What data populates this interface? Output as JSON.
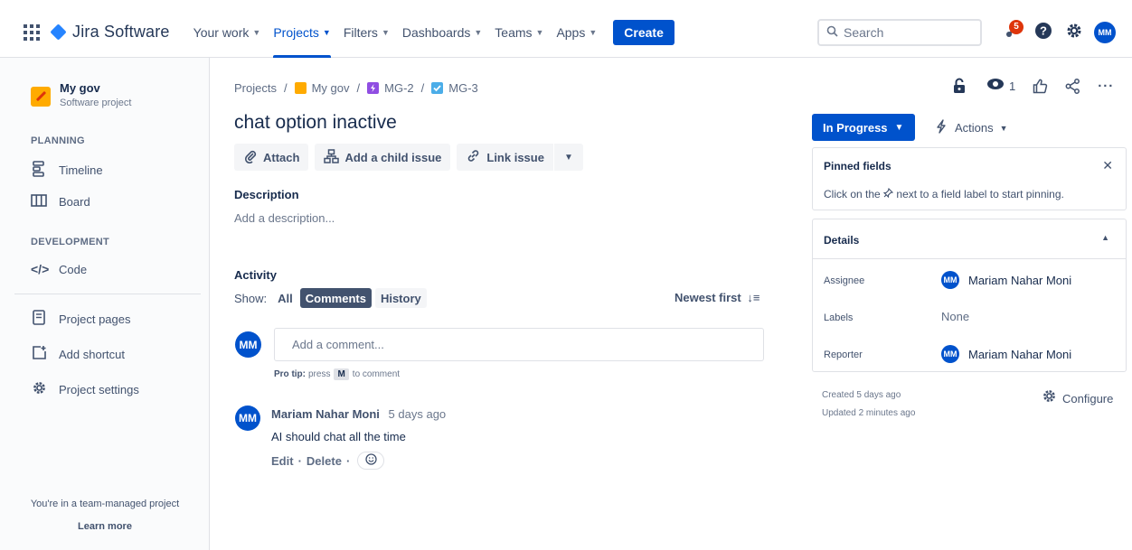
{
  "nav": {
    "app_name": "Jira Software",
    "items": [
      {
        "label": "Your work"
      },
      {
        "label": "Projects"
      },
      {
        "label": "Filters"
      },
      {
        "label": "Dashboards"
      },
      {
        "label": "Teams"
      },
      {
        "label": "Apps"
      }
    ],
    "create_label": "Create",
    "search_placeholder": "Search",
    "notification_count": "5",
    "user_initials": "MM"
  },
  "sidebar": {
    "project_name": "My gov",
    "project_type": "Software project",
    "planning_label": "PLANNING",
    "timeline": "Timeline",
    "board": "Board",
    "development_label": "DEVELOPMENT",
    "code": "Code",
    "project_pages": "Project pages",
    "add_shortcut": "Add shortcut",
    "project_settings": "Project settings",
    "footer_text": "You're in a team-managed project",
    "learn_more": "Learn more"
  },
  "breadcrumb": {
    "projects": "Projects",
    "project": "My gov",
    "parent": "MG-2",
    "issue": "MG-3"
  },
  "issue": {
    "title": "chat option inactive",
    "attach": "Attach",
    "add_child": "Add a child issue",
    "link_issue": "Link issue",
    "description_label": "Description",
    "description_placeholder": "Add a description..."
  },
  "activity": {
    "label": "Activity",
    "show_label": "Show:",
    "filters": [
      "All",
      "Comments",
      "History"
    ],
    "sort_label": "Newest first",
    "comment_placeholder": "Add a comment...",
    "protip_bold": "Pro tip:",
    "protip_press": "press",
    "protip_key": "M",
    "protip_rest": "to comment",
    "comments": [
      {
        "initials": "MM",
        "author": "Mariam Nahar Moni",
        "time": "5 days ago",
        "body": "AI should chat all the time",
        "edit": "Edit",
        "delete": "Delete"
      }
    ]
  },
  "panel": {
    "watchers": "1",
    "status": "In Progress",
    "actions_label": "Actions",
    "pinned_title": "Pinned fields",
    "pinned_text_before": "Click on the",
    "pinned_text_after": "next to a field label to start pinning.",
    "details_title": "Details",
    "assignee_label": "Assignee",
    "assignee_value": "Mariam Nahar Moni",
    "assignee_initials": "MM",
    "labels_label": "Labels",
    "labels_value": "None",
    "reporter_label": "Reporter",
    "reporter_value": "Mariam Nahar Moni",
    "reporter_initials": "MM",
    "created": "Created 5 days ago",
    "updated": "Updated 2 minutes ago",
    "configure": "Configure"
  },
  "colors": {
    "brand": "#0052cc",
    "logo": "#2684ff",
    "badge": "#de350b",
    "project_icon": "#ffab00",
    "epic_icon": "#904ee2",
    "task_icon": "#4bade8"
  }
}
